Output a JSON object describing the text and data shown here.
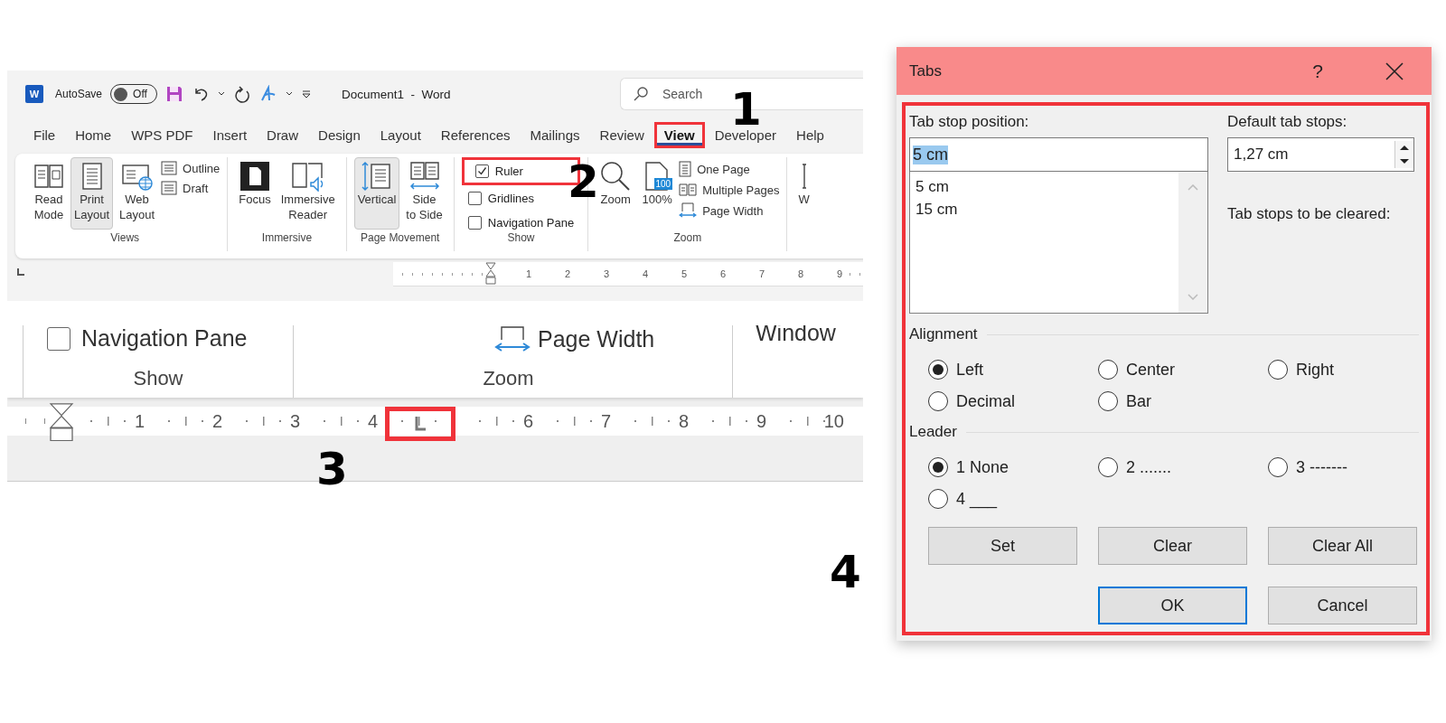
{
  "word_window": {
    "logo_letter": "W",
    "autosave_label": "AutoSave",
    "autosave_toggle": {
      "label": "Off",
      "on": false
    },
    "title": "Document1  -  Word",
    "search": {
      "placeholder": "Search"
    },
    "menu_tabs": [
      {
        "label": "File",
        "selected": false,
        "highlighted": false
      },
      {
        "label": "Home",
        "selected": false,
        "highlighted": false
      },
      {
        "label": "WPS PDF",
        "selected": false,
        "highlighted": false
      },
      {
        "label": "Insert",
        "selected": false,
        "highlighted": false
      },
      {
        "label": "Draw",
        "selected": false,
        "highlighted": false
      },
      {
        "label": "Design",
        "selected": false,
        "highlighted": false
      },
      {
        "label": "Layout",
        "selected": false,
        "highlighted": false
      },
      {
        "label": "References",
        "selected": false,
        "highlighted": false
      },
      {
        "label": "Mailings",
        "selected": false,
        "highlighted": false
      },
      {
        "label": "Review",
        "selected": false,
        "highlighted": false
      },
      {
        "label": "View",
        "selected": true,
        "highlighted": true
      },
      {
        "label": "Developer",
        "selected": false,
        "highlighted": false
      },
      {
        "label": "Help",
        "selected": false,
        "highlighted": false
      }
    ],
    "ribbon_groups": [
      {
        "label": "Views",
        "items": [
          {
            "kind": "large",
            "label": "Read\nMode",
            "selected": false
          },
          {
            "kind": "large",
            "label": "Print\nLayout",
            "selected": true
          },
          {
            "kind": "large",
            "label": "Web\nLayout",
            "selected": false
          },
          {
            "kind": "small",
            "label": "Outline"
          },
          {
            "kind": "small",
            "label": "Draft"
          }
        ]
      },
      {
        "label": "Immersive",
        "items": [
          {
            "kind": "large",
            "label": "Focus",
            "selected": false
          },
          {
            "kind": "large",
            "label": "Immersive\nReader",
            "selected": false
          }
        ]
      },
      {
        "label": "Page Movement",
        "items": [
          {
            "kind": "large",
            "label": "Vertical",
            "selected": true
          },
          {
            "kind": "large",
            "label": "Side\nto Side",
            "selected": false
          }
        ]
      },
      {
        "label": "Show",
        "items": [
          {
            "kind": "checkbox",
            "label": "Ruler",
            "checked": true,
            "highlighted": true
          },
          {
            "kind": "checkbox",
            "label": "Gridlines",
            "checked": false,
            "highlighted": false
          },
          {
            "kind": "checkbox",
            "label": "Navigation Pane",
            "checked": false,
            "highlighted": false
          }
        ]
      },
      {
        "label": "Zoom",
        "items": [
          {
            "kind": "large",
            "label": "Zoom",
            "selected": false
          },
          {
            "kind": "large",
            "label": "100%",
            "selected": false,
            "badge": "100"
          },
          {
            "kind": "small",
            "label": "One Page"
          },
          {
            "kind": "small",
            "label": "Multiple Pages"
          },
          {
            "kind": "small",
            "label": "Page Width"
          }
        ]
      },
      {
        "items": [
          {
            "kind": "large",
            "label": "W",
            "selected": false
          }
        ]
      }
    ],
    "ruler_numbers": [
      "1",
      "2",
      "3",
      "4",
      "5",
      "6",
      "7",
      "8",
      "9"
    ]
  },
  "zoomed_view": {
    "ribbon_groups": [
      {
        "label": "Show",
        "items": [
          {
            "kind": "checkbox",
            "label": "Navigation Pane",
            "checked": false
          }
        ]
      },
      {
        "label": "Zoom",
        "items": [
          {
            "kind": "small",
            "label": "Page Width"
          }
        ]
      },
      {
        "items": [
          {
            "kind": "plain",
            "label": "Window"
          }
        ]
      }
    ],
    "ruler_marks": [
      {
        "kind": "number",
        "label": "1"
      },
      {
        "kind": "number",
        "label": "2"
      },
      {
        "kind": "number",
        "label": "3"
      },
      {
        "kind": "number",
        "label": "4"
      },
      {
        "kind": "tab_stop",
        "highlighted": true
      },
      {
        "kind": "number",
        "label": "6"
      },
      {
        "kind": "number",
        "label": "7"
      },
      {
        "kind": "number",
        "label": "8"
      },
      {
        "kind": "number",
        "label": "9"
      },
      {
        "kind": "number",
        "label": "10"
      }
    ]
  },
  "tabs_dialog": {
    "title": "Tabs",
    "help_label": "?",
    "highlighted": true,
    "tab_stop_position": {
      "label": "Tab stop position:",
      "value": "5 cm",
      "text_selected": true
    },
    "tab_stop_list": [
      "5 cm",
      "15 cm"
    ],
    "default_tab_stops": {
      "label": "Default tab stops:",
      "value": "1,27 cm"
    },
    "cleared_label": "Tab stops to be cleared:",
    "alignment": {
      "label": "Alignment",
      "options": [
        {
          "label": "Left",
          "selected": true
        },
        {
          "label": "Center",
          "selected": false
        },
        {
          "label": "Right",
          "selected": false
        },
        {
          "label": "Decimal",
          "selected": false
        },
        {
          "label": "Bar",
          "selected": false
        }
      ]
    },
    "leader": {
      "label": "Leader",
      "options": [
        {
          "label": "1 None",
          "selected": true
        },
        {
          "label": "2 .......",
          "selected": false
        },
        {
          "label": "3 -------",
          "selected": false
        },
        {
          "label": "4 ___",
          "selected": false
        }
      ]
    },
    "buttons": [
      {
        "label": "Set",
        "default": false
      },
      {
        "label": "Clear",
        "default": false
      },
      {
        "label": "Clear All",
        "default": false
      },
      {
        "label": "OK",
        "default": true
      },
      {
        "label": "Cancel",
        "default": false
      }
    ]
  },
  "annotations": [
    "1",
    "2",
    "3",
    "4"
  ]
}
